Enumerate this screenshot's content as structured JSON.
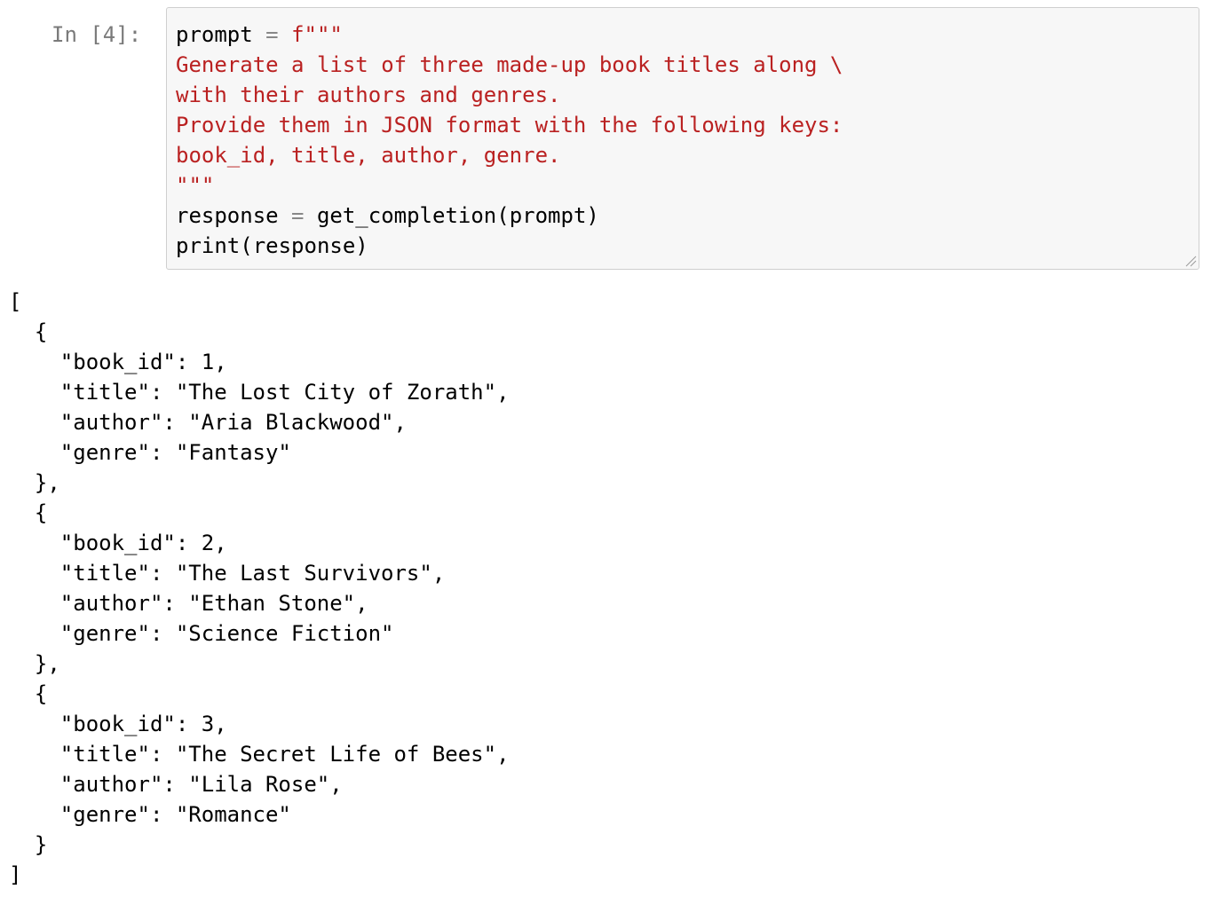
{
  "cell": {
    "prompt_label": "In [4]:",
    "code": {
      "line1": {
        "var": "prompt",
        "op": "=",
        "str": "f\"\"\""
      },
      "line2": "Generate a list of three made-up book titles along \\",
      "line3": "with their authors and genres.",
      "line4": "Provide them in JSON format with the following keys:",
      "line5": "book_id, title, author, genre.",
      "line6": "\"\"\"",
      "line7": {
        "var": "response",
        "op": "=",
        "call": "get_completion(prompt)"
      },
      "line8": "print(response)"
    }
  },
  "output": {
    "lines": [
      "[",
      "  {",
      "    \"book_id\": 1,",
      "    \"title\": \"The Lost City of Zorath\",",
      "    \"author\": \"Aria Blackwood\",",
      "    \"genre\": \"Fantasy\"",
      "  },",
      "  {",
      "    \"book_id\": 2,",
      "    \"title\": \"The Last Survivors\",",
      "    \"author\": \"Ethan Stone\",",
      "    \"genre\": \"Science Fiction\"",
      "  },",
      "  {",
      "    \"book_id\": 3,",
      "    \"title\": \"The Secret Life of Bees\",",
      "    \"author\": \"Lila Rose\",",
      "    \"genre\": \"Romance\"",
      "  }",
      "]"
    ]
  },
  "colors": {
    "string": "#ba2121",
    "operator": "#888888",
    "prompt": "#7a7a7a",
    "input_bg": "#f7f7f7",
    "input_border": "#cfcfcf"
  }
}
